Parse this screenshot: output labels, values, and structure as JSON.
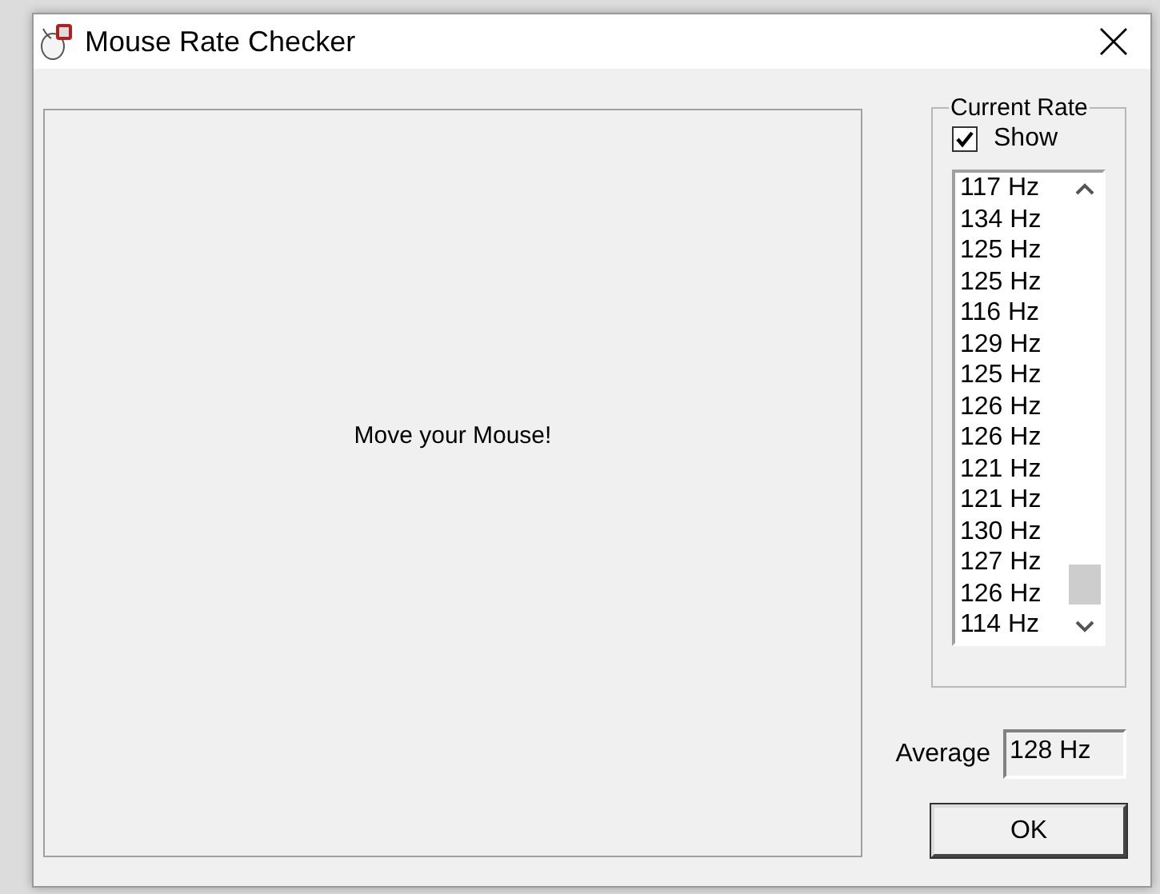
{
  "window": {
    "title": "Mouse Rate Checker"
  },
  "canvas": {
    "message": "Move your Mouse!"
  },
  "current_rate": {
    "title": "Current Rate",
    "show": {
      "label": "Show",
      "checked": true
    },
    "rates": [
      "117 Hz",
      "134 Hz",
      "125 Hz",
      "125 Hz",
      "116 Hz",
      "129 Hz",
      "125 Hz",
      "126 Hz",
      "126 Hz",
      "121 Hz",
      "121 Hz",
      "130 Hz",
      "127 Hz",
      "126 Hz",
      "114 Hz"
    ]
  },
  "average": {
    "label": "Average",
    "value": "128 Hz"
  },
  "buttons": [
    "OK"
  ]
}
